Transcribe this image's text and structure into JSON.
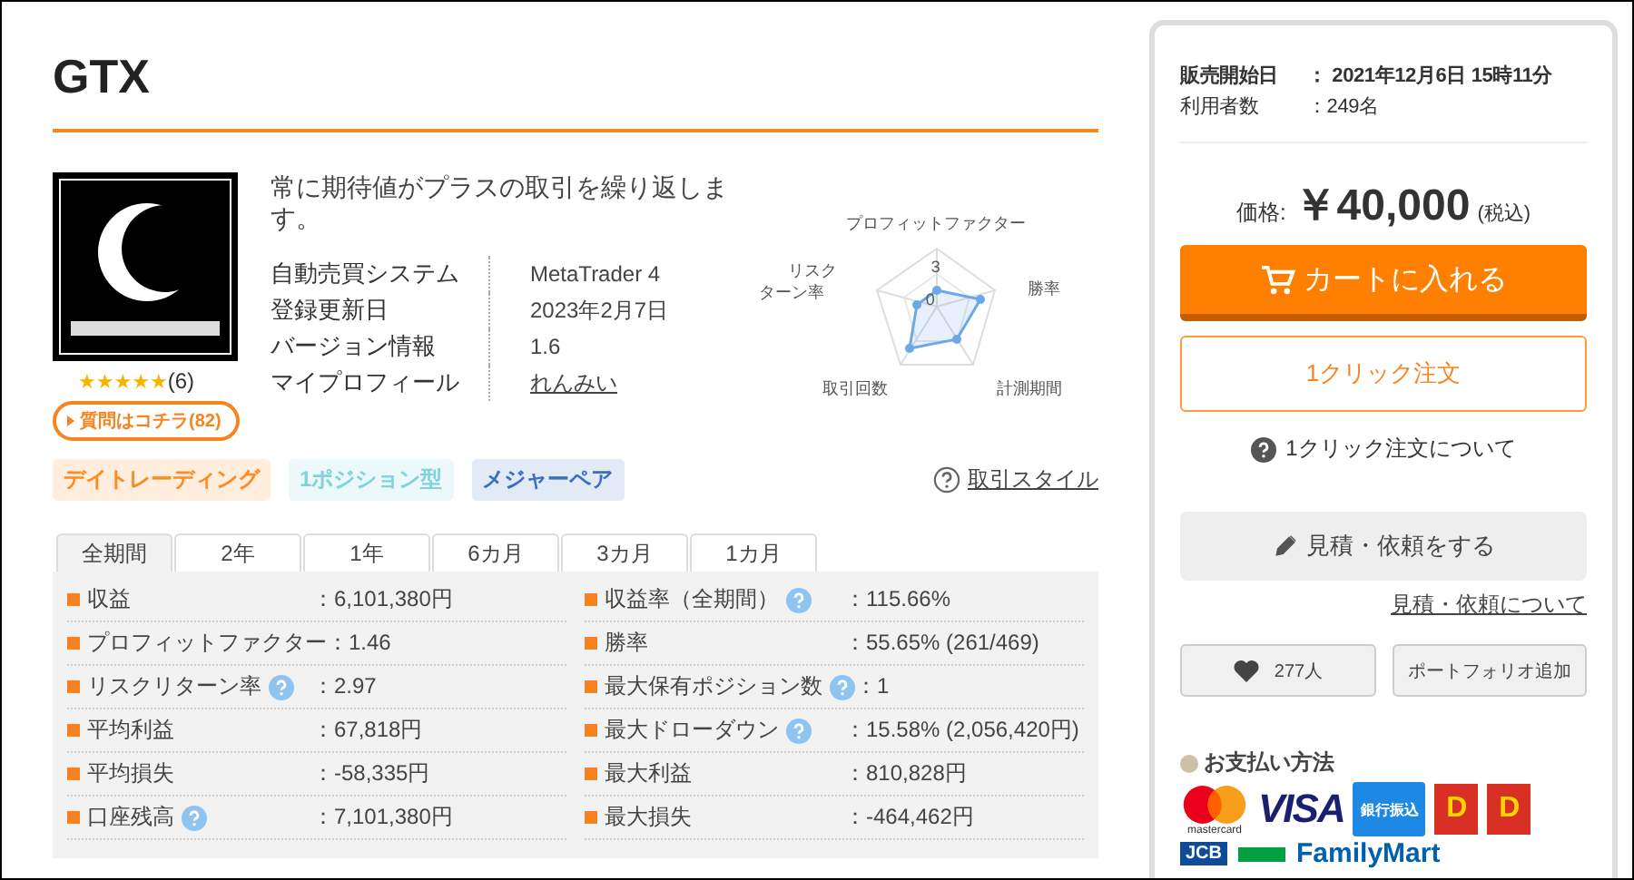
{
  "product": {
    "title": "GTX",
    "description": "常に期待値がプラスの取引を繰り返します。",
    "stars": 5,
    "review_count": "(6)",
    "question_button": "質問はコチラ(82)",
    "info": [
      {
        "label": "自動売買システム",
        "value": "MetaTrader 4",
        "kind": "text"
      },
      {
        "label": "登録更新日",
        "value": "2023年2月7日",
        "kind": "text"
      },
      {
        "label": "バージョン情報",
        "value": "1.6",
        "kind": "text"
      },
      {
        "label": "マイプロフィール",
        "value": "れんみい",
        "kind": "link"
      }
    ],
    "radar": {
      "labels": [
        "プロフィットファクター",
        "勝率",
        "計測期間",
        "取引回数",
        "リスク",
        "ターン率"
      ],
      "ticks": [
        "3",
        "0"
      ]
    },
    "tags": [
      {
        "label": "デイトレーディング",
        "color": "#ff8a1f"
      },
      {
        "label": "1ポジション型",
        "color": "#7fd3da"
      },
      {
        "label": "メジャーペア",
        "color": "#3a6fc4"
      }
    ],
    "style_link": "取引スタイル"
  },
  "tabs": [
    {
      "label": "全期間",
      "selected": true
    },
    {
      "label": "2年",
      "selected": false
    },
    {
      "label": "1年",
      "selected": false
    },
    {
      "label": "6カ月",
      "selected": false
    },
    {
      "label": "3カ月",
      "selected": false
    },
    {
      "label": "1カ月",
      "selected": false
    }
  ],
  "stats_left": [
    {
      "label": "収益",
      "value": "：6,101,380円",
      "help": false
    },
    {
      "label": "プロフィットファクター",
      "value": "：1.46",
      "help": false
    },
    {
      "label": "リスクリターン率",
      "value": "：2.97",
      "help": true
    },
    {
      "label": "平均利益",
      "value": "：67,818円",
      "help": false
    },
    {
      "label": "平均損失",
      "value": "：-58,335円",
      "help": false
    },
    {
      "label": "口座残高",
      "value": "：7,101,380円",
      "help": true
    }
  ],
  "stats_right": [
    {
      "label": "収益率（全期間）",
      "value": "：115.66%",
      "help": true
    },
    {
      "label": "勝率",
      "value": "：55.65% (261/469)",
      "help": false
    },
    {
      "label": "最大保有ポジション数",
      "value": "：1",
      "help": true
    },
    {
      "label": "最大ドローダウン",
      "value": "：15.58% (2,056,420円)",
      "help": true
    },
    {
      "label": "最大利益",
      "value": "：810,828円",
      "help": false
    },
    {
      "label": "最大損失",
      "value": "：-464,462円",
      "help": false
    }
  ],
  "sidebar": {
    "info": [
      {
        "label": "販売開始日",
        "value": "： 2021年12月6日 15時11分",
        "bold": true
      },
      {
        "label": "利用者数",
        "value": "：249名",
        "bold": false
      }
    ],
    "price_label": "価格:",
    "price": "￥40,000",
    "tax": "(税込)",
    "cart_button": "カートに入れる",
    "one_click_button": "1クリック注文",
    "one_click_help": "1クリック注文について",
    "estimate_button": "見積・依頼をする",
    "estimate_link": "見積・依頼について",
    "favorite_count": "277人",
    "portfolio_button": "ポートフォリオ追加",
    "payment_title": "お支払い方法",
    "payments": [
      {
        "kind": "mastercard",
        "text": "mastercard"
      },
      {
        "kind": "visa",
        "text": "VISA"
      },
      {
        "kind": "bank",
        "text": "銀行振込"
      },
      {
        "kind": "daily",
        "text": "D"
      },
      {
        "kind": "daily",
        "text": "D"
      }
    ],
    "payments_row2": [
      {
        "kind": "jcb",
        "text": "JCB"
      },
      {
        "kind": "green"
      },
      {
        "kind": "famima",
        "text": "FamilyMart"
      }
    ]
  }
}
